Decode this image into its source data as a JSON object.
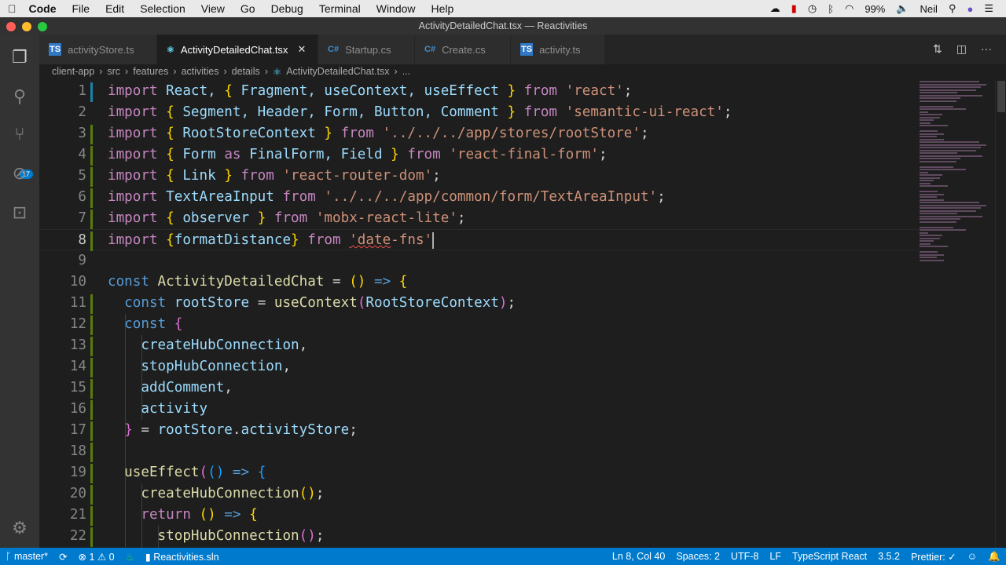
{
  "menubar": {
    "app": "Code",
    "items": [
      "File",
      "Edit",
      "Selection",
      "View",
      "Go",
      "Debug",
      "Terminal",
      "Window",
      "Help"
    ],
    "battery": "99%",
    "user": "Neil"
  },
  "window": {
    "title": "ActivityDetailedChat.tsx — Reactivities"
  },
  "activity_bar": {
    "scm_badge": "17"
  },
  "tabs": [
    {
      "label": "activityStore.ts",
      "icon": "TS"
    },
    {
      "label": "ActivityDetailedChat.tsx",
      "icon": "⚛",
      "active": true
    },
    {
      "label": "Startup.cs",
      "icon": "C#"
    },
    {
      "label": "Create.cs",
      "icon": "C#"
    },
    {
      "label": "activity.ts",
      "icon": "TS"
    }
  ],
  "breadcrumb": [
    "client-app",
    "src",
    "features",
    "activities",
    "details",
    "ActivityDetailedChat.tsx",
    "..."
  ],
  "editor": {
    "current_line": 8,
    "lines": [
      {
        "n": "1",
        "g": "#1b81a8",
        "t": [
          [
            "import",
            "k"
          ],
          [
            " React, ",
            "v"
          ],
          [
            "{",
            "b1"
          ],
          [
            " Fragment, useContext, useEffect ",
            "v"
          ],
          [
            "}",
            "b1"
          ],
          [
            " from ",
            "k"
          ],
          [
            "'react'",
            "t"
          ],
          [
            ";",
            "p"
          ]
        ]
      },
      {
        "n": "2",
        "g": "",
        "t": [
          [
            "import",
            "k"
          ],
          [
            " ",
            "p"
          ],
          [
            "{",
            "b1"
          ],
          [
            " Segment, Header, Form, Button, Comment ",
            "v"
          ],
          [
            "}",
            "b1"
          ],
          [
            " from ",
            "k"
          ],
          [
            "'semantic-ui-react'",
            "t"
          ],
          [
            ";",
            "p"
          ]
        ]
      },
      {
        "n": "3",
        "g": "#587c0c",
        "t": [
          [
            "import",
            "k"
          ],
          [
            " ",
            "p"
          ],
          [
            "{",
            "b1"
          ],
          [
            " RootStoreContext ",
            "v"
          ],
          [
            "}",
            "b1"
          ],
          [
            " from ",
            "k"
          ],
          [
            "'../../../app/stores/rootStore'",
            "t"
          ],
          [
            ";",
            "p"
          ]
        ]
      },
      {
        "n": "4",
        "g": "#587c0c",
        "t": [
          [
            "import",
            "k"
          ],
          [
            " ",
            "p"
          ],
          [
            "{",
            "b1"
          ],
          [
            " Form ",
            "v"
          ],
          [
            "as",
            "k"
          ],
          [
            " FinalForm, Field ",
            "v"
          ],
          [
            "}",
            "b1"
          ],
          [
            " from ",
            "k"
          ],
          [
            "'react-final-form'",
            "t"
          ],
          [
            ";",
            "p"
          ]
        ]
      },
      {
        "n": "5",
        "g": "#587c0c",
        "t": [
          [
            "import",
            "k"
          ],
          [
            " ",
            "p"
          ],
          [
            "{",
            "b1"
          ],
          [
            " Link ",
            "v"
          ],
          [
            "}",
            "b1"
          ],
          [
            " from ",
            "k"
          ],
          [
            "'react-router-dom'",
            "t"
          ],
          [
            ";",
            "p"
          ]
        ]
      },
      {
        "n": "6",
        "g": "#587c0c",
        "t": [
          [
            "import",
            "k"
          ],
          [
            " TextAreaInput ",
            "v"
          ],
          [
            "from",
            "k"
          ],
          [
            " ",
            "p"
          ],
          [
            "'../../../app/common/form/TextAreaInput'",
            "t"
          ],
          [
            ";",
            "p"
          ]
        ]
      },
      {
        "n": "7",
        "g": "#587c0c",
        "t": [
          [
            "import",
            "k"
          ],
          [
            " ",
            "p"
          ],
          [
            "{",
            "b1"
          ],
          [
            " observer ",
            "v"
          ],
          [
            "}",
            "b1"
          ],
          [
            " from ",
            "k"
          ],
          [
            "'mobx-react-lite'",
            "t"
          ],
          [
            ";",
            "p"
          ]
        ]
      },
      {
        "n": "8",
        "g": "#587c0c",
        "t": [
          [
            "import",
            "k"
          ],
          [
            " ",
            "p"
          ],
          [
            "{",
            "b1"
          ],
          [
            "formatDistance",
            "v"
          ],
          [
            "}",
            "b1"
          ],
          [
            " from ",
            "k"
          ],
          [
            "'date",
            "t sq"
          ],
          [
            "-fns'",
            "t"
          ]
        ]
      },
      {
        "n": "9",
        "g": "",
        "t": []
      },
      {
        "n": "10",
        "g": "",
        "t": [
          [
            "const",
            "s"
          ],
          [
            " ActivityDetailedChat ",
            "f"
          ],
          [
            "= ",
            "p"
          ],
          [
            "()",
            "b1"
          ],
          [
            " => ",
            "s"
          ],
          [
            "{",
            "b1"
          ]
        ]
      },
      {
        "n": "11",
        "g": "#587c0c",
        "t": [
          [
            "  const",
            "s"
          ],
          [
            " rootStore ",
            "v"
          ],
          [
            "= ",
            "p"
          ],
          [
            "useContext",
            "f"
          ],
          [
            "(",
            "b2"
          ],
          [
            "RootStoreContext",
            "v"
          ],
          [
            ")",
            "b2"
          ],
          [
            ";",
            "p"
          ]
        ]
      },
      {
        "n": "12",
        "g": "#587c0c",
        "t": [
          [
            "  const",
            "s"
          ],
          [
            " ",
            "p"
          ],
          [
            "{",
            "b2"
          ]
        ]
      },
      {
        "n": "13",
        "g": "#587c0c",
        "t": [
          [
            "    createHubConnection",
            "v"
          ],
          [
            ",",
            "p"
          ]
        ]
      },
      {
        "n": "14",
        "g": "#587c0c",
        "t": [
          [
            "    stopHubConnection",
            "v"
          ],
          [
            ",",
            "p"
          ]
        ]
      },
      {
        "n": "15",
        "g": "#587c0c",
        "t": [
          [
            "    addComment",
            "v"
          ],
          [
            ",",
            "p"
          ]
        ]
      },
      {
        "n": "16",
        "g": "#587c0c",
        "t": [
          [
            "    activity",
            "v"
          ]
        ]
      },
      {
        "n": "17",
        "g": "#587c0c",
        "t": [
          [
            "  ",
            "p"
          ],
          [
            "}",
            "b2"
          ],
          [
            " = ",
            "p"
          ],
          [
            "rootStore",
            "v"
          ],
          [
            ".",
            "p"
          ],
          [
            "activityStore",
            "v"
          ],
          [
            ";",
            "p"
          ]
        ]
      },
      {
        "n": "18",
        "g": "#587c0c",
        "t": []
      },
      {
        "n": "19",
        "g": "#587c0c",
        "t": [
          [
            "  useEffect",
            "f"
          ],
          [
            "(",
            "b2"
          ],
          [
            "()",
            "b3"
          ],
          [
            " => ",
            "s"
          ],
          [
            "{",
            "b3"
          ]
        ]
      },
      {
        "n": "20",
        "g": "#587c0c",
        "t": [
          [
            "    createHubConnection",
            "f"
          ],
          [
            "()",
            "b1"
          ],
          [
            ";",
            "p"
          ]
        ]
      },
      {
        "n": "21",
        "g": "#587c0c",
        "t": [
          [
            "    return",
            "k"
          ],
          [
            " ",
            "p"
          ],
          [
            "()",
            "b1"
          ],
          [
            " => ",
            "s"
          ],
          [
            "{",
            "b1"
          ]
        ]
      },
      {
        "n": "22",
        "g": "#587c0c",
        "t": [
          [
            "      stopHubConnection",
            "f"
          ],
          [
            "()",
            "b2"
          ],
          [
            ";",
            "p"
          ]
        ]
      }
    ]
  },
  "statusbar": {
    "branch": "master*",
    "errors": "1",
    "warnings": "0",
    "solution": "Reactivities.sln",
    "position": "Ln 8, Col 40",
    "spaces": "Spaces: 2",
    "encoding": "UTF-8",
    "eol": "LF",
    "language": "TypeScript React",
    "ts_version": "3.5.2",
    "prettier": "Prettier: ✓"
  },
  "colors": {
    "statusbar": "#007acc",
    "activity_bar": "#333333",
    "editor_bg": "#1e1e1e"
  }
}
